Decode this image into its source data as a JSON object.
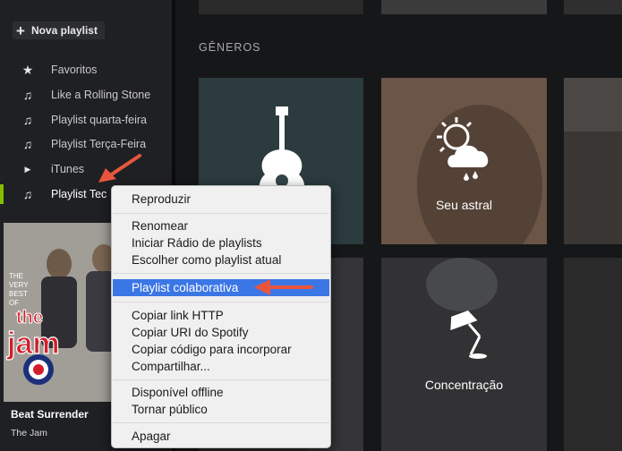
{
  "sidebar": {
    "new_playlist": "Nova playlist",
    "items": [
      {
        "label": "Favoritos",
        "icon": "star-icon"
      },
      {
        "label": "Like a Rolling Stone",
        "icon": "music-note-icon"
      },
      {
        "label": "Playlist quarta-feira",
        "icon": "music-note-icon"
      },
      {
        "label": "Playlist Terça-Feira",
        "icon": "shared-playlist-icon"
      },
      {
        "label": "iTunes",
        "icon": "play-triangle-icon"
      },
      {
        "label": "Playlist Tec",
        "icon": "music-note-icon",
        "active": true
      }
    ]
  },
  "now_playing": {
    "album_lines": [
      "THE",
      "VERY",
      "BEST",
      "OF",
      "the",
      "jam"
    ],
    "title": "Beat Surrender",
    "artist": "The Jam"
  },
  "main": {
    "section_title": "GÊNEROS",
    "tiles": [
      {
        "label": "",
        "icon": "guitar-icon"
      },
      {
        "label": "Seu astral",
        "icon": "sun-cloud-icon"
      },
      {
        "label": "",
        "icon": ""
      },
      {
        "label": "Concentração",
        "icon": "desk-lamp-icon"
      }
    ]
  },
  "context_menu": {
    "groups": [
      [
        "Reproduzir"
      ],
      [
        "Renomear",
        "Iniciar Rádio de playlists",
        "Escolher como playlist atual"
      ],
      [
        "Playlist colaborativa"
      ],
      [
        "Copiar link HTTP",
        "Copiar URI do Spotify",
        "Copiar código para incorporar",
        "Compartilhar..."
      ],
      [
        "Disponível offline",
        "Tornar público"
      ],
      [
        "Apagar"
      ]
    ],
    "highlighted": "Playlist colaborativa"
  },
  "colors": {
    "accent": "#84bd00",
    "highlight": "#3b76e5",
    "arrow": "#e8553e"
  }
}
